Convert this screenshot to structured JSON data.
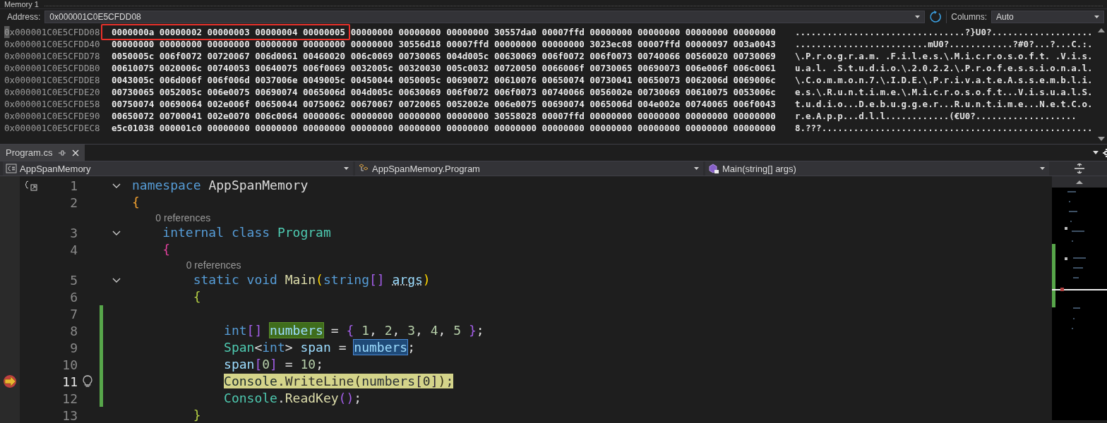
{
  "memory": {
    "title": "Memory 1",
    "address_label": "Address:",
    "address": "0x000001C0E5CFDD08",
    "columns_label": "Columns:",
    "columns": "Auto",
    "rows": [
      {
        "address": "0x000001C0E5CFDD08",
        "caret": true,
        "groups": [
          {
            "outlined": true,
            "words": [
              "0000000a",
              "00000002",
              "00000003",
              "00000004",
              "00000005"
            ]
          },
          {
            "outlined": false,
            "words": [
              "00000000",
              "00000000",
              "00000000",
              "30557da0",
              "00007ffd",
              "00000000",
              "00000000",
              "00000000",
              "00000000"
            ]
          }
        ],
        "ascii": "................................?}U0?..................."
      },
      {
        "address": "0x000001C0E5CFDD40",
        "caret": false,
        "groups": [
          {
            "outlined": false,
            "words": [
              "00000000",
              "00000000",
              "00000000",
              "00000000",
              "00000000",
              "00000000",
              "30556d18",
              "00007ffd",
              "00000000",
              "00000000",
              "3023ec08",
              "00007ffd",
              "00000097",
              "003a0043"
            ]
          }
        ],
        "ascii": ".........................mU0?............?#0?...?...C.:."
      },
      {
        "address": "0x000001C0E5CFDD78",
        "caret": false,
        "groups": [
          {
            "outlined": false,
            "words": [
              "0050005c",
              "006f0072",
              "00720067",
              "006d0061",
              "00460020",
              "006c0069",
              "00730065",
              "004d005c",
              "00630069",
              "006f0072",
              "006f0073",
              "00740066",
              "00560020",
              "00730069"
            ]
          }
        ],
        "ascii": "\\.P.r.o.g.r.a.m. .F.i.l.e.s.\\.M.i.c.r.o.s.o.f.t. .V.i.s."
      },
      {
        "address": "0x000001C0E5CFDDB0",
        "caret": false,
        "groups": [
          {
            "outlined": false,
            "words": [
              "00610075",
              "0020006c",
              "00740053",
              "00640075",
              "006f0069",
              "0032005c",
              "00320030",
              "005c0032",
              "00720050",
              "0066006f",
              "00730065",
              "00690073",
              "006e006f",
              "006c0061"
            ]
          }
        ],
        "ascii": "u.a.l. .S.t.u.d.i.o.\\.2.0.2.2.\\.P.r.o.f.e.s.s.i.o.n.a.l."
      },
      {
        "address": "0x000001C0E5CFDDE8",
        "caret": false,
        "groups": [
          {
            "outlined": false,
            "words": [
              "0043005c",
              "006d006f",
              "006f006d",
              "0037006e",
              "0049005c",
              "00450044",
              "0050005c",
              "00690072",
              "00610076",
              "00650074",
              "00730041",
              "00650073",
              "0062006d",
              "0069006c"
            ]
          }
        ],
        "ascii": "\\.C.o.m.m.o.n.7.\\.I.D.E.\\.P.r.i.v.a.t.e.A.s.s.e.m.b.l.i."
      },
      {
        "address": "0x000001C0E5CFDE20",
        "caret": false,
        "groups": [
          {
            "outlined": false,
            "words": [
              "00730065",
              "0052005c",
              "006e0075",
              "00690074",
              "0065006d",
              "004d005c",
              "00630069",
              "006f0072",
              "006f0073",
              "00740066",
              "0056002e",
              "00730069",
              "00610075",
              "0053006c"
            ]
          }
        ],
        "ascii": "e.s.\\.R.u.n.t.i.m.e.\\.M.i.c.r.o.s.o.f.t...V.i.s.u.a.l.S."
      },
      {
        "address": "0x000001C0E5CFDE58",
        "caret": false,
        "groups": [
          {
            "outlined": false,
            "words": [
              "00750074",
              "00690064",
              "002e006f",
              "00650044",
              "00750062",
              "00670067",
              "00720065",
              "0052002e",
              "006e0075",
              "00690074",
              "0065006d",
              "004e002e",
              "00740065",
              "006f0043"
            ]
          }
        ],
        "ascii": "t.u.d.i.o...D.e.b.u.g.g.e.r...R.u.n.t.i.m.e...N.e.t.C.o."
      },
      {
        "address": "0x000001C0E5CFDE90",
        "caret": false,
        "groups": [
          {
            "outlined": false,
            "words": [
              "00650072",
              "00700041",
              "002e0070",
              "006c0064",
              "0000006c",
              "00000000",
              "00000000",
              "00000000",
              "30558028",
              "00007ffd",
              "00000000",
              "00000000",
              "00000000",
              "00000000"
            ]
          }
        ],
        "ascii": "r.e.A.p.p...d.l.l............(€U0?..................."
      },
      {
        "address": "0x000001C0E5CFDEC8",
        "caret": false,
        "groups": [
          {
            "outlined": false,
            "words": [
              "e5c01038",
              "000001c0",
              "00000000",
              "00000000",
              "00000000",
              "00000000",
              "00000000",
              "00000000",
              "00000000",
              "00000000",
              "00000000",
              "00000000",
              "00000000",
              "00000000"
            ]
          }
        ],
        "ascii": "8.???..................................................."
      }
    ]
  },
  "editor": {
    "tabs": [
      {
        "label": "Program.cs",
        "selected": true
      }
    ],
    "nav": [
      {
        "kind": "project",
        "label": "AppSpanMemory"
      },
      {
        "kind": "class",
        "label": "AppSpanMemory.Program"
      },
      {
        "kind": "method",
        "label": "Main(string[] args)"
      }
    ],
    "lines": [
      {
        "number": "1",
        "fold": true,
        "changed": false,
        "current": false,
        "scope_marker": true,
        "execution_arrow": false,
        "lightbulb": false,
        "tokens": [
          {
            "text": "namespace ",
            "kind": "keyword"
          },
          {
            "text": "AppSpanMemory",
            "kind": "plain"
          }
        ]
      },
      {
        "number": "2",
        "fold": false,
        "changed": false,
        "current": false,
        "scope_marker": false,
        "execution_arrow": false,
        "lightbulb": false,
        "tokens": [
          {
            "text": "{",
            "kind": "brace-gold"
          }
        ]
      },
      {
        "number": "3",
        "fold": true,
        "changed": false,
        "current": false,
        "scope_marker": false,
        "execution_arrow": false,
        "lightbulb": false,
        "lens": "0 references",
        "tokens": [
          {
            "text": "    internal class ",
            "kind": "keyword"
          },
          {
            "text": "Program",
            "kind": "type"
          }
        ]
      },
      {
        "number": "4",
        "fold": false,
        "changed": false,
        "current": false,
        "scope_marker": false,
        "execution_arrow": false,
        "lightbulb": false,
        "tokens": [
          {
            "text": "    {",
            "kind": "brace-pink"
          }
        ]
      },
      {
        "number": "5",
        "fold": true,
        "changed": false,
        "current": false,
        "scope_marker": false,
        "execution_arrow": false,
        "lightbulb": false,
        "lens": "0 references",
        "tokens": [
          {
            "text": "        static void ",
            "kind": "keyword"
          },
          {
            "text": "Main",
            "kind": "method"
          },
          {
            "text": "(",
            "kind": "paren-gold"
          },
          {
            "text": "string",
            "kind": "keyword"
          },
          {
            "text": "[] ",
            "kind": "bracket-purple"
          },
          {
            "text": "args",
            "kind": "param-hint"
          },
          {
            "text": ")",
            "kind": "paren-gold"
          }
        ]
      },
      {
        "number": "6",
        "fold": false,
        "changed": false,
        "current": false,
        "scope_marker": false,
        "execution_arrow": false,
        "lightbulb": false,
        "tokens": [
          {
            "text": "        {",
            "kind": "brace-lime"
          }
        ]
      },
      {
        "number": "7",
        "fold": false,
        "changed": true,
        "current": false,
        "scope_marker": false,
        "execution_arrow": false,
        "lightbulb": false
      },
      {
        "number": "8",
        "fold": false,
        "changed": true,
        "current": false,
        "scope_marker": false,
        "execution_arrow": false,
        "lightbulb": false,
        "tokens": [
          {
            "text": "            int",
            "kind": "keyword"
          },
          {
            "text": "[] ",
            "kind": "bracket-purple"
          },
          {
            "text": "numbers",
            "kind": "local-write"
          },
          {
            "text": " = ",
            "kind": "plain"
          },
          {
            "text": "{ ",
            "kind": "bracket-purple"
          },
          {
            "text": "1",
            "kind": "number"
          },
          {
            "text": ", ",
            "kind": "plain"
          },
          {
            "text": "2",
            "kind": "number"
          },
          {
            "text": ", ",
            "kind": "plain"
          },
          {
            "text": "3",
            "kind": "number"
          },
          {
            "text": ", ",
            "kind": "plain"
          },
          {
            "text": "4",
            "kind": "number"
          },
          {
            "text": ", ",
            "kind": "plain"
          },
          {
            "text": "5 ",
            "kind": "number"
          },
          {
            "text": "}",
            "kind": "bracket-purple"
          },
          {
            "text": ";",
            "kind": "plain"
          }
        ]
      },
      {
        "number": "9",
        "fold": false,
        "changed": true,
        "current": false,
        "scope_marker": false,
        "execution_arrow": false,
        "lightbulb": false,
        "tokens": [
          {
            "text": "            Span",
            "kind": "type"
          },
          {
            "text": "<",
            "kind": "plain"
          },
          {
            "text": "int",
            "kind": "keyword"
          },
          {
            "text": "> ",
            "kind": "plain"
          },
          {
            "text": "span",
            "kind": "local"
          },
          {
            "text": " = ",
            "kind": "plain"
          },
          {
            "text": "numbers",
            "kind": "local-read"
          },
          {
            "text": ";",
            "kind": "plain"
          }
        ]
      },
      {
        "number": "10",
        "fold": false,
        "changed": true,
        "current": false,
        "scope_marker": false,
        "execution_arrow": false,
        "lightbulb": false,
        "tokens": [
          {
            "text": "            span",
            "kind": "local"
          },
          {
            "text": "[",
            "kind": "bracket-purple"
          },
          {
            "text": "0",
            "kind": "number"
          },
          {
            "text": "]",
            "kind": "bracket-purple"
          },
          {
            "text": " = ",
            "kind": "plain"
          },
          {
            "text": "10",
            "kind": "number"
          },
          {
            "text": ";",
            "kind": "plain"
          }
        ]
      },
      {
        "number": "11",
        "fold": false,
        "changed": true,
        "current": true,
        "scope_marker": false,
        "execution_arrow": true,
        "lightbulb": true,
        "tokens": [
          {
            "text": "            Console",
            "kind": "type"
          },
          {
            "text": ".",
            "kind": "plain"
          },
          {
            "text": "WriteLine",
            "kind": "method"
          },
          {
            "text": "(",
            "kind": "paren-gold"
          },
          {
            "text": "numbers",
            "kind": "local"
          },
          {
            "text": "[",
            "kind": "bracket-purple"
          },
          {
            "text": "0",
            "kind": "number"
          },
          {
            "text": "]",
            "kind": "bracket-purple"
          },
          {
            "text": ")",
            "kind": "paren-gold"
          },
          {
            "text": ";",
            "kind": "plain"
          }
        ]
      },
      {
        "number": "12",
        "fold": false,
        "changed": true,
        "current": false,
        "scope_marker": false,
        "execution_arrow": false,
        "lightbulb": false,
        "tokens": [
          {
            "text": "            Console",
            "kind": "type"
          },
          {
            "text": ".",
            "kind": "plain"
          },
          {
            "text": "ReadKey",
            "kind": "method"
          },
          {
            "text": "()",
            "kind": "bracket-purple"
          },
          {
            "text": ";",
            "kind": "plain"
          }
        ]
      },
      {
        "number": "13",
        "fold": false,
        "changed": false,
        "current": false,
        "scope_marker": false,
        "execution_arrow": false,
        "lightbulb": false,
        "tokens": [
          {
            "text": "        }",
            "kind": "brace-lime"
          }
        ]
      }
    ]
  }
}
